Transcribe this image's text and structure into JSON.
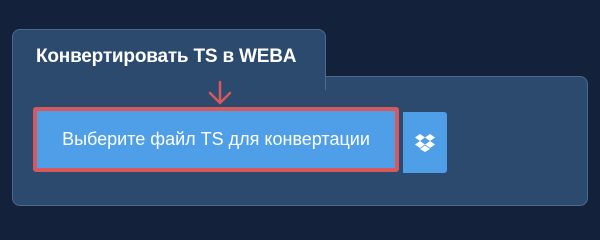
{
  "converter": {
    "title": "Конвертировать TS в WEBA",
    "file_button_label": "Выберите файл TS для конвертации"
  },
  "icons": {
    "arrow": "arrow-down-icon",
    "dropbox": "dropbox-icon"
  },
  "colors": {
    "page_background": "#13223a",
    "panel_background": "#2c4a6e",
    "button_blue": "#4f9fe8",
    "highlight_red": "#d8595b"
  }
}
